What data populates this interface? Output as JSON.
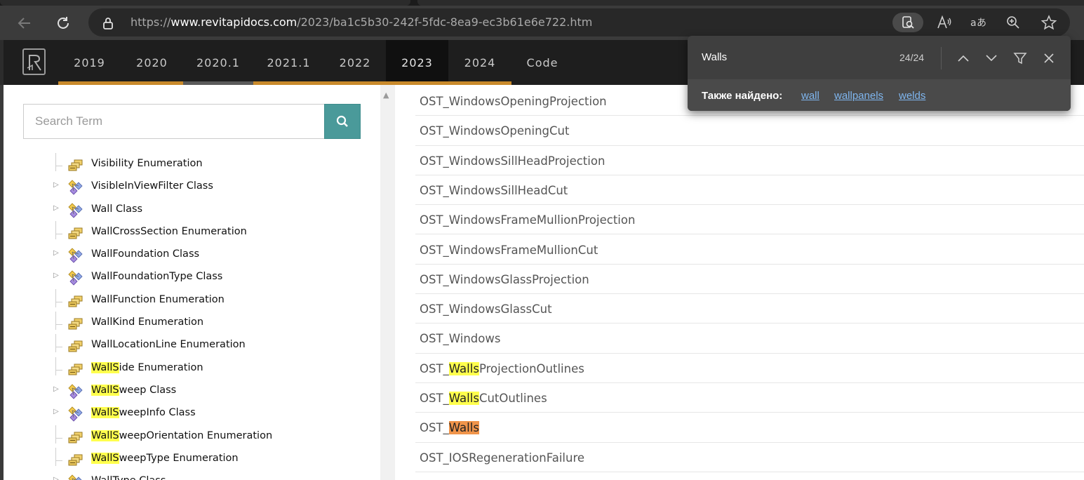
{
  "browser": {
    "url_scheme": "https://",
    "url_host": "www.revitapidocs.com",
    "url_path": "/2023/ba1c5b30-242f-5fdc-8ea9-ec3b61e6e722.htm"
  },
  "header": {
    "version_tabs": [
      {
        "label": "2019",
        "bar_color": "#c98a2b",
        "active": false
      },
      {
        "label": "2020",
        "bar_color": "#c98a2b",
        "active": false
      },
      {
        "label": "2020.1",
        "bar_color": "#5a5a5a",
        "active": false
      },
      {
        "label": "2021.1",
        "bar_color": "#c98a2b",
        "active": false
      },
      {
        "label": "2022",
        "bar_color": "#c98a2b",
        "active": false
      },
      {
        "label": "2023",
        "bar_color": "#c98a2b",
        "active": true
      },
      {
        "label": "2024",
        "bar_color": "#c98a2b",
        "active": false
      },
      {
        "label": "Code",
        "bar_color": null,
        "active": false
      }
    ]
  },
  "sidebar": {
    "search_placeholder": "Search Term",
    "tree": [
      {
        "pre": "",
        "hl": "",
        "post": "Visibility Enumeration",
        "kind": "enum",
        "expandable": false
      },
      {
        "pre": "",
        "hl": "",
        "post": "VisibleInViewFilter Class",
        "kind": "class",
        "expandable": true
      },
      {
        "pre": "",
        "hl": "",
        "post": "Wall Class",
        "kind": "class",
        "expandable": true
      },
      {
        "pre": "",
        "hl": "",
        "post": "WallCrossSection Enumeration",
        "kind": "enum",
        "expandable": false
      },
      {
        "pre": "",
        "hl": "",
        "post": "WallFoundation Class",
        "kind": "class",
        "expandable": true
      },
      {
        "pre": "",
        "hl": "",
        "post": "WallFoundationType Class",
        "kind": "class",
        "expandable": true
      },
      {
        "pre": "",
        "hl": "",
        "post": "WallFunction Enumeration",
        "kind": "enum",
        "expandable": false
      },
      {
        "pre": "",
        "hl": "",
        "post": "WallKind Enumeration",
        "kind": "enum",
        "expandable": false
      },
      {
        "pre": "",
        "hl": "",
        "post": "WallLocationLine Enumeration",
        "kind": "enum",
        "expandable": false
      },
      {
        "pre": "",
        "hl": "WallS",
        "post": "ide Enumeration",
        "kind": "enum",
        "expandable": false
      },
      {
        "pre": "",
        "hl": "WallS",
        "post": "weep Class",
        "kind": "class",
        "expandable": true
      },
      {
        "pre": "",
        "hl": "WallS",
        "post": "weepInfo Class",
        "kind": "class",
        "expandable": true
      },
      {
        "pre": "",
        "hl": "WallS",
        "post": "weepOrientation Enumeration",
        "kind": "enum",
        "expandable": false
      },
      {
        "pre": "",
        "hl": "WallS",
        "post": "weepType Enumeration",
        "kind": "enum",
        "expandable": false
      },
      {
        "pre": "",
        "hl": "",
        "post": "WallType Class",
        "kind": "class",
        "expandable": true
      }
    ]
  },
  "main": {
    "rows": [
      {
        "pre": "OST_WindowsOpeningProjection",
        "hl": "",
        "post": "",
        "current": false
      },
      {
        "pre": "OST_WindowsOpeningCut",
        "hl": "",
        "post": "",
        "current": false
      },
      {
        "pre": "OST_WindowsSillHeadProjection",
        "hl": "",
        "post": "",
        "current": false
      },
      {
        "pre": "OST_WindowsSillHeadCut",
        "hl": "",
        "post": "",
        "current": false
      },
      {
        "pre": "OST_WindowsFrameMullionProjection",
        "hl": "",
        "post": "",
        "current": false
      },
      {
        "pre": "OST_WindowsFrameMullionCut",
        "hl": "",
        "post": "",
        "current": false
      },
      {
        "pre": "OST_WindowsGlassProjection",
        "hl": "",
        "post": "",
        "current": false
      },
      {
        "pre": "OST_WindowsGlassCut",
        "hl": "",
        "post": "",
        "current": false
      },
      {
        "pre": "OST_Windows",
        "hl": "",
        "post": "",
        "current": false
      },
      {
        "pre": "OST_",
        "hl": "Walls",
        "post": "ProjectionOutlines",
        "current": false
      },
      {
        "pre": "OST_",
        "hl": "Walls",
        "post": "CutOutlines",
        "current": false
      },
      {
        "pre": "OST_",
        "hl": "Walls",
        "post": "",
        "current": true
      },
      {
        "pre": "OST_IOSRegenerationFailure",
        "hl": "",
        "post": "",
        "current": false
      },
      {
        "pre": "",
        "hl": "",
        "post": "",
        "current": false
      }
    ]
  },
  "findbar": {
    "query": "Walls",
    "count": "24/24",
    "also_found_label": "Также найдено:",
    "suggestions": [
      "wall",
      "wallpanels",
      "welds"
    ]
  },
  "colors": {
    "highlight": "#ffff4d",
    "current_match": "#f0944a",
    "search_button": "#4a9a9a",
    "tab_accent": "#c98a2b"
  }
}
